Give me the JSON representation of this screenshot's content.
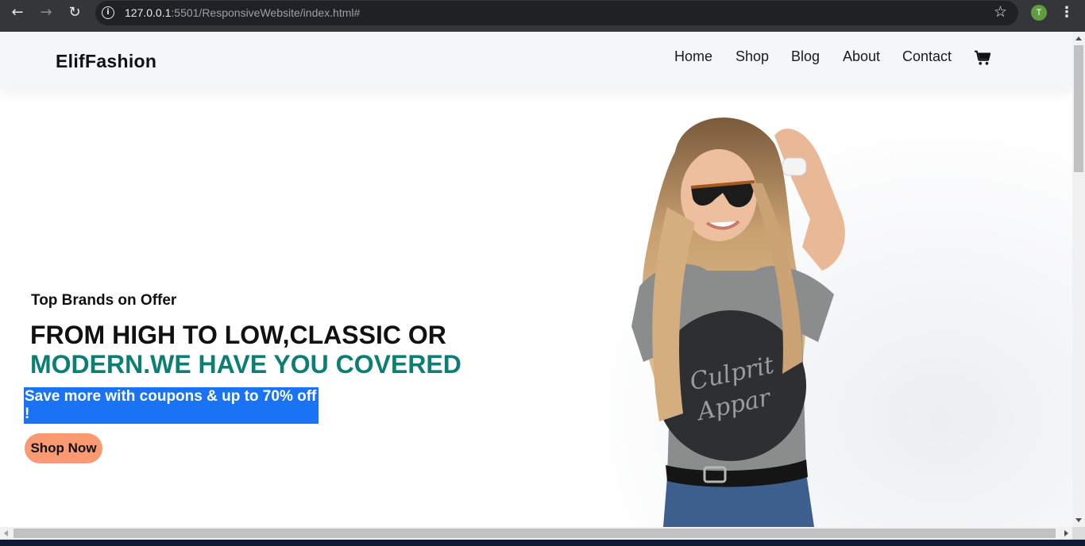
{
  "browser": {
    "url_host": "127.0.0.1",
    "url_rest": ":5501/ResponsiveWebsite/index.html#",
    "profile_initial": "T"
  },
  "site": {
    "logo": "ElifFashion",
    "menu": [
      "Home",
      "Shop",
      "Blog",
      "About",
      "Contact"
    ]
  },
  "hero": {
    "subtitle": "Top Brands on Offer",
    "headline_line1": "FROM HIGH TO LOW,CLASSIC OR",
    "headline_line2": "MODERN.WE HAVE YOU COVERED",
    "promo": "Save more with coupons & up to 70% off !",
    "cta": "Shop Now",
    "image_shirt_text": "Culprit Apparel"
  },
  "colors": {
    "accent_teal": "#0d7e72",
    "promo_blue": "#1a73f5",
    "cta_salmon": "#fb9a72"
  },
  "icons": [
    "back-icon",
    "forward-icon",
    "reload-icon",
    "info-icon",
    "star-icon",
    "cart-icon",
    "kebab-menu-icon"
  ]
}
